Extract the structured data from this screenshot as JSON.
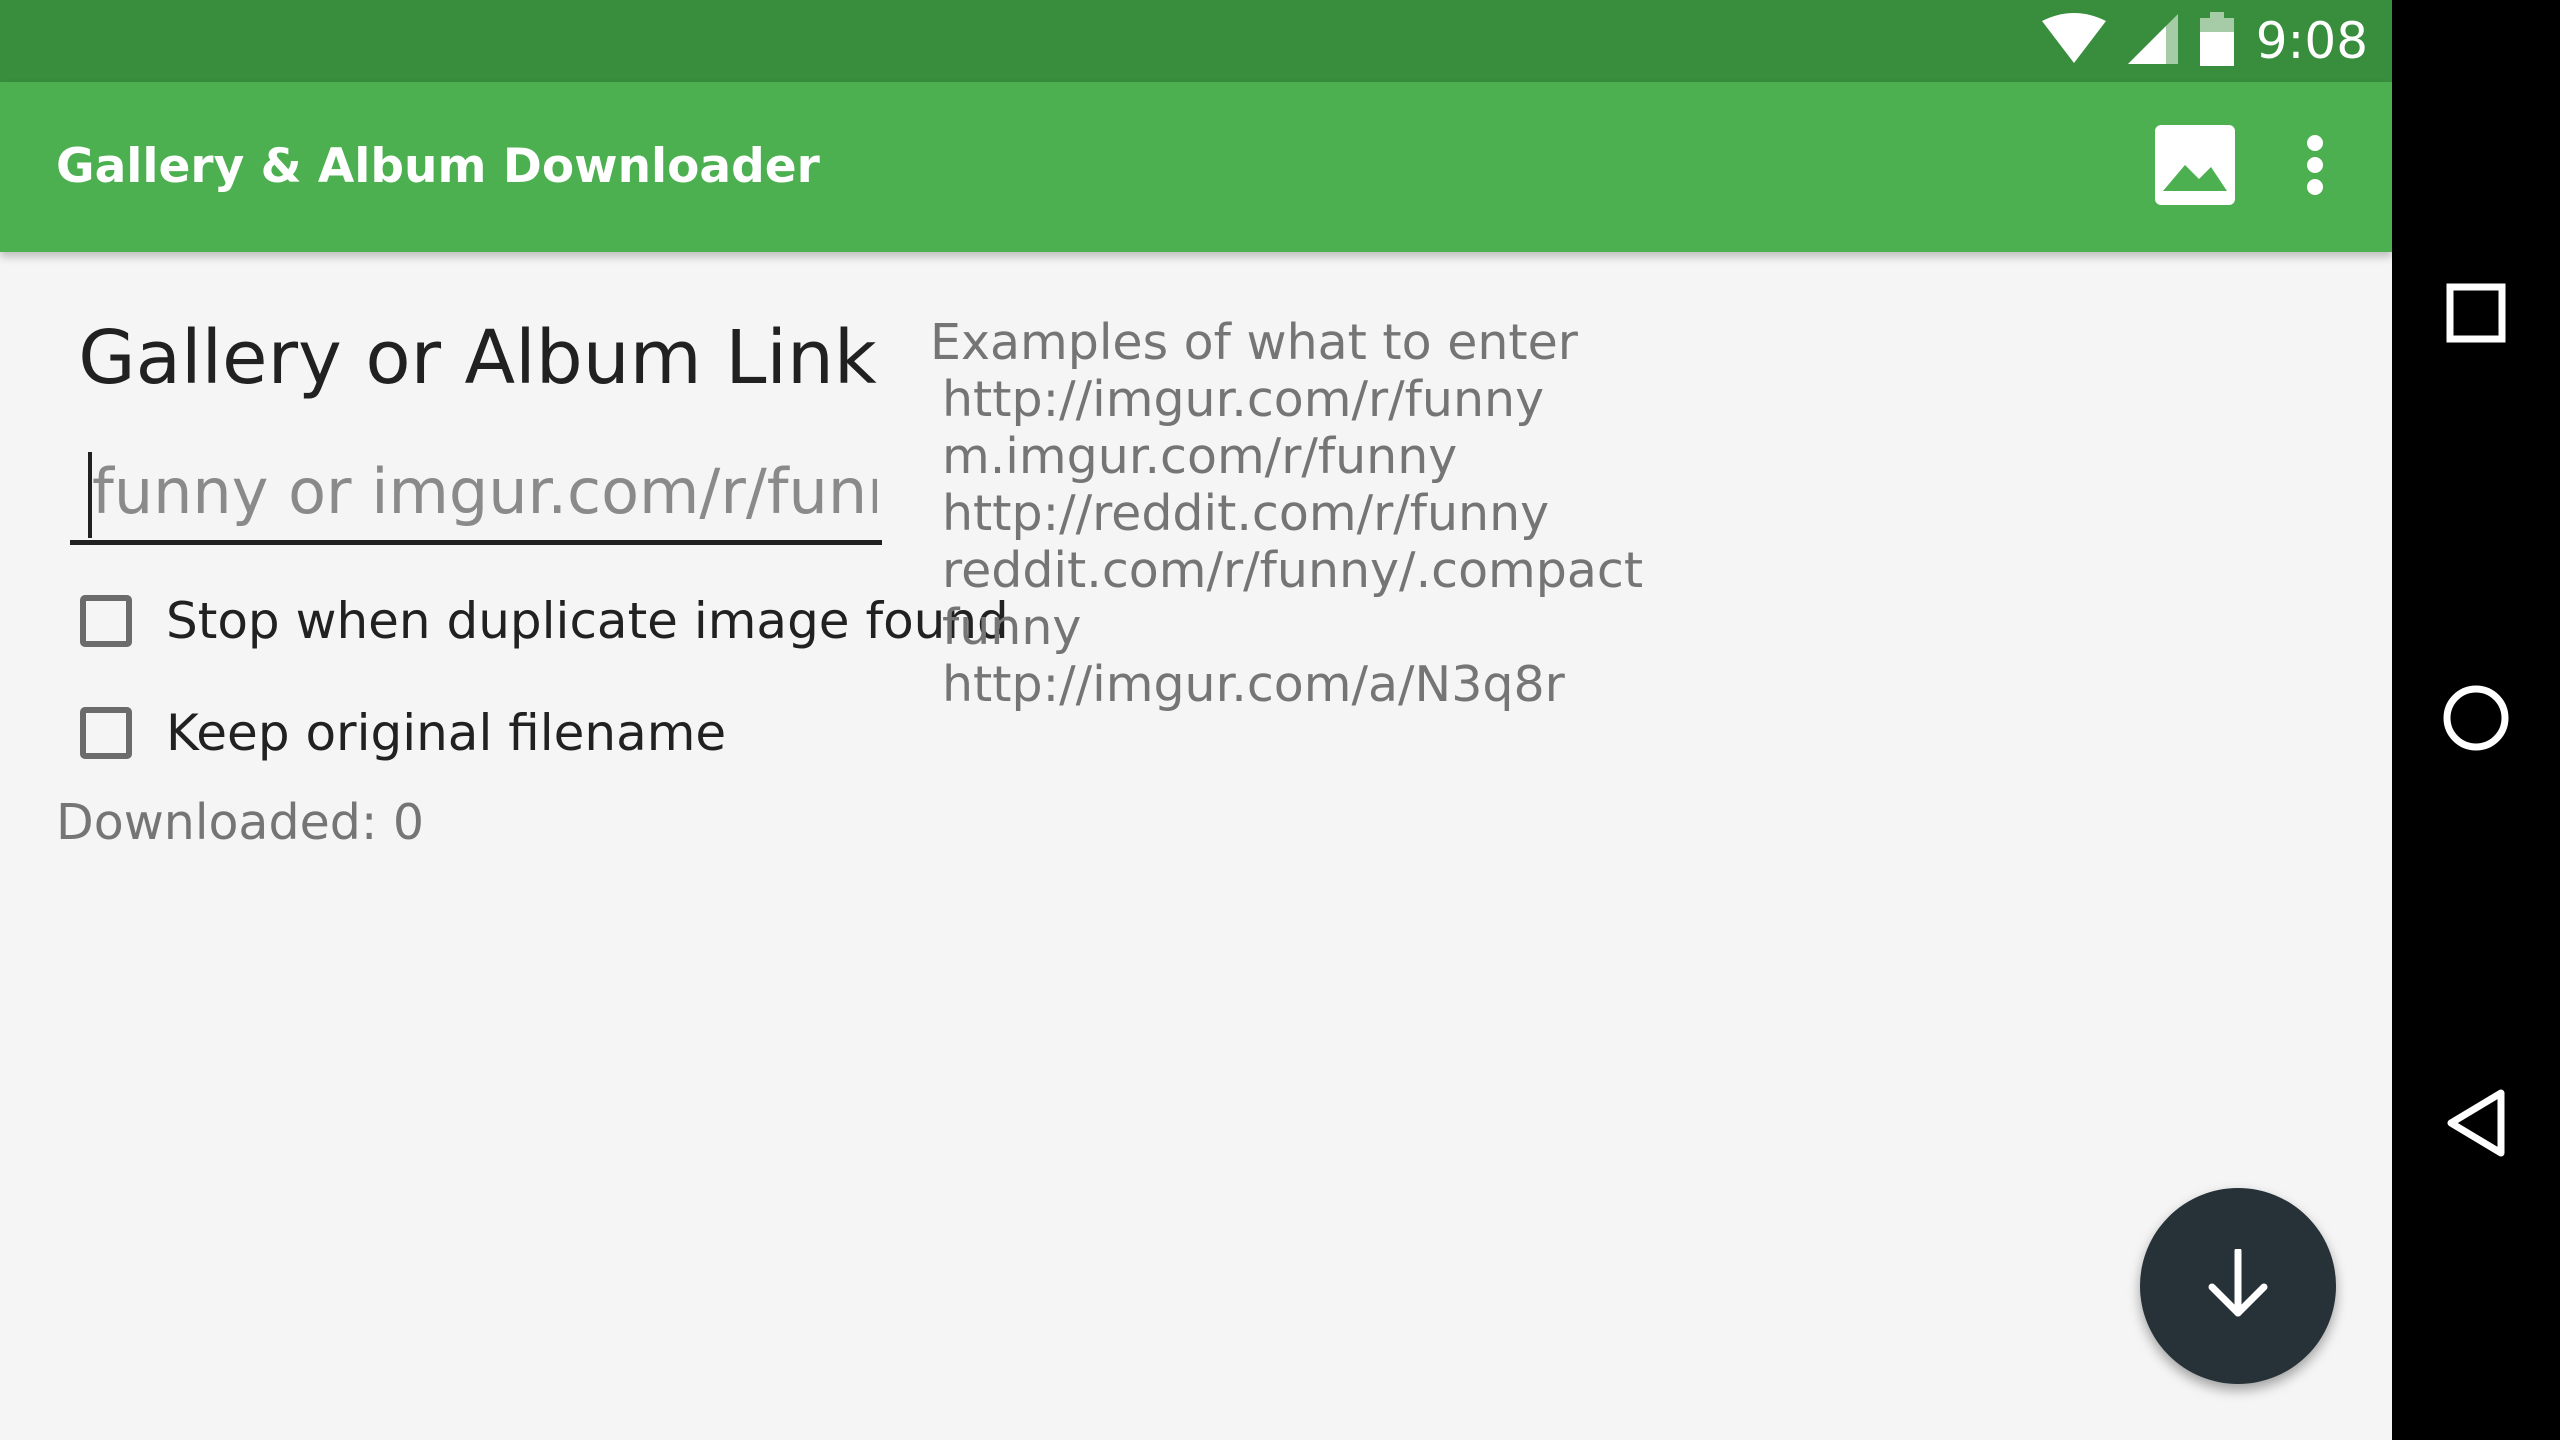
{
  "status_bar": {
    "time": "9:08",
    "icons": [
      "wifi-icon",
      "cell-signal-icon",
      "battery-icon"
    ]
  },
  "app_bar": {
    "title": "Gallery & Album Downloader",
    "actions": [
      "gallery-icon",
      "overflow-menu-icon"
    ]
  },
  "form": {
    "heading": "Gallery or Album Link",
    "link_input": {
      "placeholder": "funny or imgur.com/r/funny",
      "value": ""
    },
    "checkboxes": [
      {
        "label": "Stop when duplicate image found",
        "checked": false
      },
      {
        "label": "Keep original filename",
        "checked": false
      }
    ],
    "downloaded_label": "Downloaded: 0"
  },
  "examples": {
    "title": "Examples of what to enter",
    "items": [
      "http://imgur.com/r/funny",
      "m.imgur.com/r/funny",
      "http://reddit.com/r/funny",
      "reddit.com/r/funny/.compact",
      "funny",
      "http://imgur.com/a/N3q8r"
    ]
  },
  "fab": {
    "icon": "arrow-down-icon"
  },
  "nav_bar": {
    "buttons": [
      "recents-square-icon",
      "home-circle-icon",
      "back-triangle-icon"
    ]
  },
  "colors": {
    "status_bar": "#388e3c",
    "app_bar": "#4caf50",
    "background": "#f5f5f5",
    "fab": "#263238",
    "nav_bar": "#000000"
  }
}
